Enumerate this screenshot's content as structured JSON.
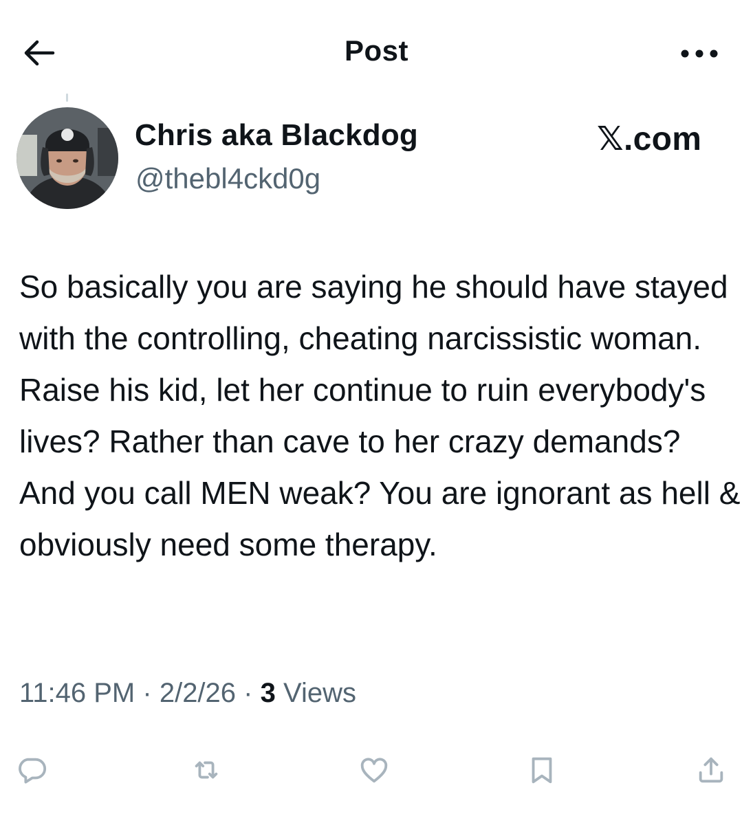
{
  "header": {
    "title": "Post",
    "back_icon": "arrow-left-icon",
    "more_icon": "more-horizontal-icon"
  },
  "tweet": {
    "author": {
      "display_name": "Chris aka Blackdog",
      "handle": "@thebl4ckd0g"
    },
    "watermark": "𝕏.com",
    "text": "So basically you are saying he should have stayed with the controlling, cheating narcissistic woman. Raise his kid, let her continue to ruin everybody's lives? Rather than cave to her crazy demands? And you call MEN weak? You are ignorant as hell & obviously need some therapy.",
    "time": "11:46 PM",
    "separator": "·",
    "date": "2/2/26",
    "views_count": "3",
    "views_label": "Views"
  },
  "actions": [
    {
      "name": "reply",
      "icon": "reply-icon"
    },
    {
      "name": "repost",
      "icon": "repost-icon"
    },
    {
      "name": "like",
      "icon": "heart-icon"
    },
    {
      "name": "bookmark",
      "icon": "bookmark-icon"
    },
    {
      "name": "share",
      "icon": "share-icon"
    }
  ],
  "colors": {
    "text_primary": "#0f1419",
    "text_secondary": "#536471",
    "action_icon": "#a8b4bd",
    "background": "#ffffff"
  }
}
